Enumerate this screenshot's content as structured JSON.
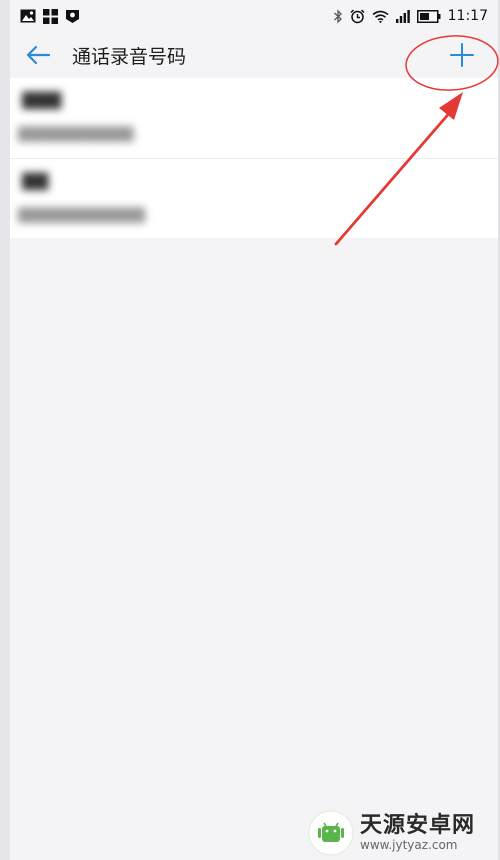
{
  "status_bar": {
    "time": "11:17",
    "left_icons": [
      "image-icon",
      "apps-grid-icon",
      "shield-notification-icon"
    ],
    "right_icons": [
      "bluetooth-icon",
      "alarm-icon",
      "wifi-icon",
      "signal-icon",
      "battery-icon"
    ]
  },
  "app_bar": {
    "title": "通话录音号码",
    "back_icon": "arrow-left-icon",
    "add_icon": "plus-icon"
  },
  "contacts": [
    {
      "name": "▇▇▇",
      "number": "▇▇▇▇▇▇▇▇▇▇"
    },
    {
      "name": "▇▇",
      "number": "▇▇▇▇▇▇▇▇▇▇▇"
    }
  ],
  "annotation": {
    "color": "#e53935"
  },
  "watermark": {
    "title": "天源安卓网",
    "url": "www.jytyaz.com"
  },
  "colors": {
    "accent": "#2b8ad6",
    "background": "#f4f4f6"
  }
}
